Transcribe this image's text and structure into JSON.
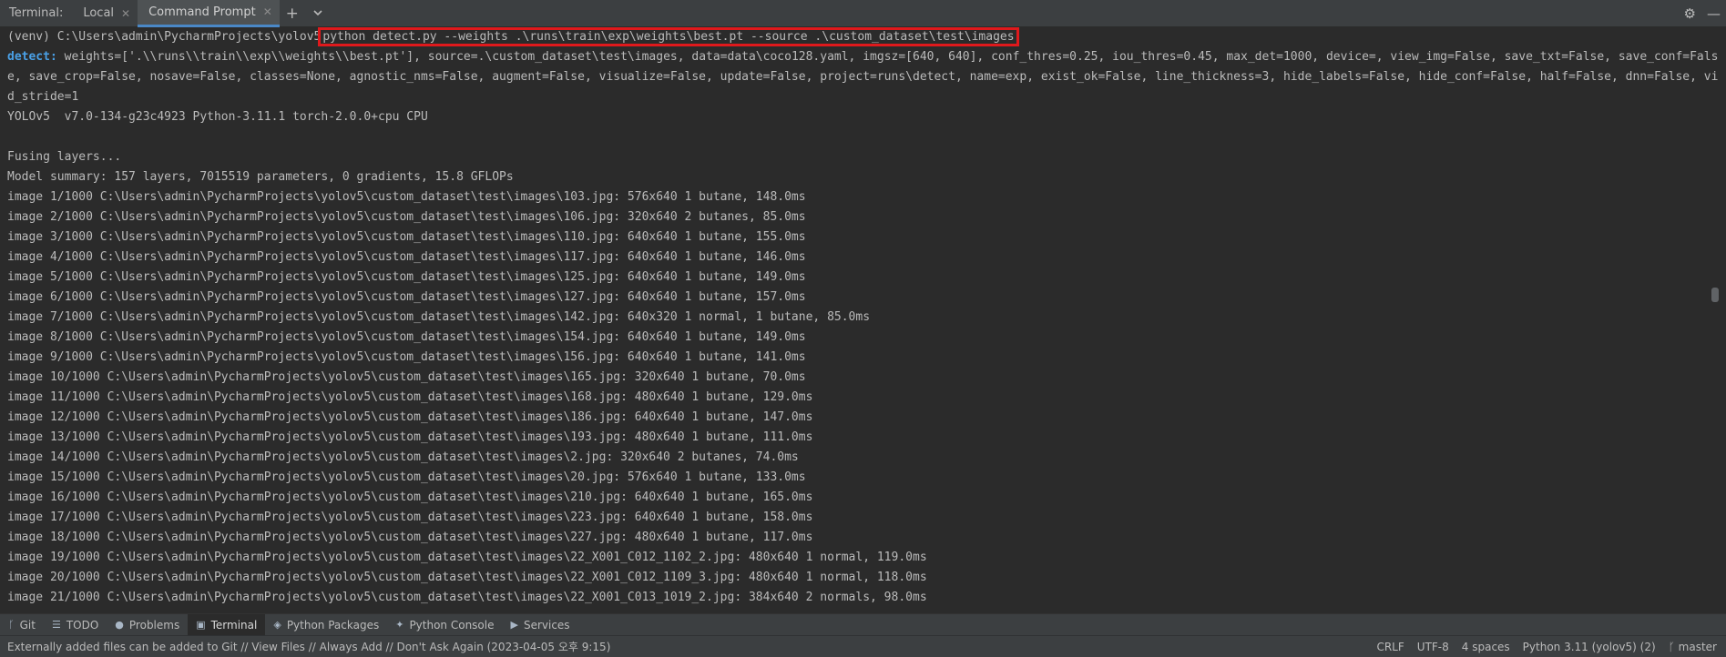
{
  "topbar": {
    "label": "Terminal:",
    "tabs": [
      {
        "label": "Local"
      },
      {
        "label": "Command Prompt"
      }
    ],
    "add_icon": "+",
    "menu_icon": "⌄"
  },
  "terminal": {
    "prompt": "(venv) C:\\Users\\admin\\PycharmProjects\\yolov5",
    "command": "python detect.py --weights .\\runs\\train\\exp\\weights\\best.pt --source .\\custom_dataset\\test\\images",
    "detect_label": "detect:",
    "detect_args": " weights=['.\\\\runs\\\\train\\\\exp\\\\weights\\\\best.pt'], source=.\\custom_dataset\\test\\images, data=data\\coco128.yaml, imgsz=[640, 640], conf_thres=0.25, iou_thres=0.45, max_det=1000, device=, view_img=False, save_txt=False, save_conf=False, save_crop=False, nosave=False, classes=None, agnostic_nms=False, augment=False, visualize=False, update=False, project=runs\\detect, name=exp, exist_ok=False, line_thickness=3, hide_labels=False, hide_conf=False, half=False, dnn=False, vid_stride=1",
    "version_line": "YOLOv5  v7.0-134-g23c4923 Python-3.11.1 torch-2.0.0+cpu CPU",
    "blank": "",
    "fusing": "Fusing layers...",
    "summary": "Model summary: 157 layers, 7015519 parameters, 0 gradients, 15.8 GFLOPs",
    "lines": [
      "image 1/1000 C:\\Users\\admin\\PycharmProjects\\yolov5\\custom_dataset\\test\\images\\103.jpg: 576x640 1 butane, 148.0ms",
      "image 2/1000 C:\\Users\\admin\\PycharmProjects\\yolov5\\custom_dataset\\test\\images\\106.jpg: 320x640 2 butanes, 85.0ms",
      "image 3/1000 C:\\Users\\admin\\PycharmProjects\\yolov5\\custom_dataset\\test\\images\\110.jpg: 640x640 1 butane, 155.0ms",
      "image 4/1000 C:\\Users\\admin\\PycharmProjects\\yolov5\\custom_dataset\\test\\images\\117.jpg: 640x640 1 butane, 146.0ms",
      "image 5/1000 C:\\Users\\admin\\PycharmProjects\\yolov5\\custom_dataset\\test\\images\\125.jpg: 640x640 1 butane, 149.0ms",
      "image 6/1000 C:\\Users\\admin\\PycharmProjects\\yolov5\\custom_dataset\\test\\images\\127.jpg: 640x640 1 butane, 157.0ms",
      "image 7/1000 C:\\Users\\admin\\PycharmProjects\\yolov5\\custom_dataset\\test\\images\\142.jpg: 640x320 1 normal, 1 butane, 85.0ms",
      "image 8/1000 C:\\Users\\admin\\PycharmProjects\\yolov5\\custom_dataset\\test\\images\\154.jpg: 640x640 1 butane, 149.0ms",
      "image 9/1000 C:\\Users\\admin\\PycharmProjects\\yolov5\\custom_dataset\\test\\images\\156.jpg: 640x640 1 butane, 141.0ms",
      "image 10/1000 C:\\Users\\admin\\PycharmProjects\\yolov5\\custom_dataset\\test\\images\\165.jpg: 320x640 1 butane, 70.0ms",
      "image 11/1000 C:\\Users\\admin\\PycharmProjects\\yolov5\\custom_dataset\\test\\images\\168.jpg: 480x640 1 butane, 129.0ms",
      "image 12/1000 C:\\Users\\admin\\PycharmProjects\\yolov5\\custom_dataset\\test\\images\\186.jpg: 640x640 1 butane, 147.0ms",
      "image 13/1000 C:\\Users\\admin\\PycharmProjects\\yolov5\\custom_dataset\\test\\images\\193.jpg: 480x640 1 butane, 111.0ms",
      "image 14/1000 C:\\Users\\admin\\PycharmProjects\\yolov5\\custom_dataset\\test\\images\\2.jpg: 320x640 2 butanes, 74.0ms",
      "image 15/1000 C:\\Users\\admin\\PycharmProjects\\yolov5\\custom_dataset\\test\\images\\20.jpg: 576x640 1 butane, 133.0ms",
      "image 16/1000 C:\\Users\\admin\\PycharmProjects\\yolov5\\custom_dataset\\test\\images\\210.jpg: 640x640 1 butane, 165.0ms",
      "image 17/1000 C:\\Users\\admin\\PycharmProjects\\yolov5\\custom_dataset\\test\\images\\223.jpg: 640x640 1 butane, 158.0ms",
      "image 18/1000 C:\\Users\\admin\\PycharmProjects\\yolov5\\custom_dataset\\test\\images\\227.jpg: 480x640 1 butane, 117.0ms",
      "image 19/1000 C:\\Users\\admin\\PycharmProjects\\yolov5\\custom_dataset\\test\\images\\22_X001_C012_1102_2.jpg: 480x640 1 normal, 119.0ms",
      "image 20/1000 C:\\Users\\admin\\PycharmProjects\\yolov5\\custom_dataset\\test\\images\\22_X001_C012_1109_3.jpg: 480x640 1 normal, 118.0ms",
      "image 21/1000 C:\\Users\\admin\\PycharmProjects\\yolov5\\custom_dataset\\test\\images\\22_X001_C013_1019_2.jpg: 384x640 2 normals, 98.0ms"
    ]
  },
  "tool_windows": [
    {
      "label": "Git",
      "icon": "git-branch-icon"
    },
    {
      "label": "TODO",
      "icon": "list-icon"
    },
    {
      "label": "Problems",
      "icon": "problems-icon"
    },
    {
      "label": "Terminal",
      "icon": "terminal-icon"
    },
    {
      "label": "Python Packages",
      "icon": "layers-icon"
    },
    {
      "label": "Python Console",
      "icon": "python-icon"
    },
    {
      "label": "Services",
      "icon": "services-icon"
    }
  ],
  "status": {
    "message": "Externally added files can be added to Git // View Files // Always Add // Don't Ask Again (2023-04-05 오후 9:15)",
    "line_sep": "CRLF",
    "encoding": "UTF-8",
    "indent": "4 spaces",
    "interpreter": "Python 3.11 (yolov5) (2)",
    "branch": "master"
  },
  "colors": {
    "highlight_box": "#e0191c",
    "detect_label": "#4aa0e6",
    "background": "#2b2b2b"
  }
}
